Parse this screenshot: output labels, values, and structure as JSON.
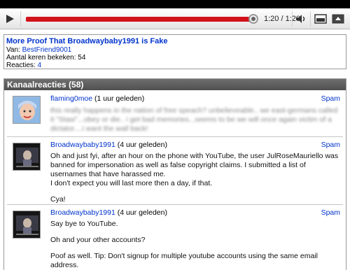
{
  "player": {
    "current_time": "1:20",
    "time_separator": " / ",
    "total_time": "1:20",
    "progress": 1.0,
    "accent_color": "#d2121a",
    "icons": [
      "play-icon",
      "volume-icon",
      "normal-size-icon",
      "fullscreen-icon"
    ]
  },
  "video": {
    "title": "More Proof That Broadwaybaby1991 is Fake",
    "from_label": "Van: ",
    "from_user": "BestFriend9001",
    "views_label": "Aantal keren bekeken: ",
    "views": "54",
    "replies_label": "Reacties: ",
    "replies": "4"
  },
  "comments_section": {
    "title": "Kanaalreacties (58)",
    "comments": [
      {
        "author": "flaming0moe",
        "age": " (1 uur geleden)",
        "spam_label": "Spam",
        "text": "this really happens in the nation of free speach? unbelieveable.. we east-germans called it \"Stasi\"...obey or die.. i get bad memories...seems to be we will once again victim of a dictator....i want the wall back!"
      },
      {
        "author": "Broadwaybaby1991",
        "age": " (4 uur geleden)",
        "spam_label": "Spam",
        "para1": "Oh and just fyi, after an hour on the phone with YouTube, the user JulRoseMauriello was banned for impersonation as well as false copyright claims. I submitted a list of usernames that have harassed me.",
        "para2": "I don't expect you will last more then a day, if that.",
        "para3": "Cya!"
      },
      {
        "author": "Broadwaybaby1991",
        "age": " (4 uur geleden)",
        "spam_label": "Spam",
        "para1": "Say bye to YouTube.",
        "para2": "Oh and your other accounts?",
        "para3": "Poof as well. Tip: Don't signup for multiple youtube accounts using the same email address."
      }
    ]
  }
}
